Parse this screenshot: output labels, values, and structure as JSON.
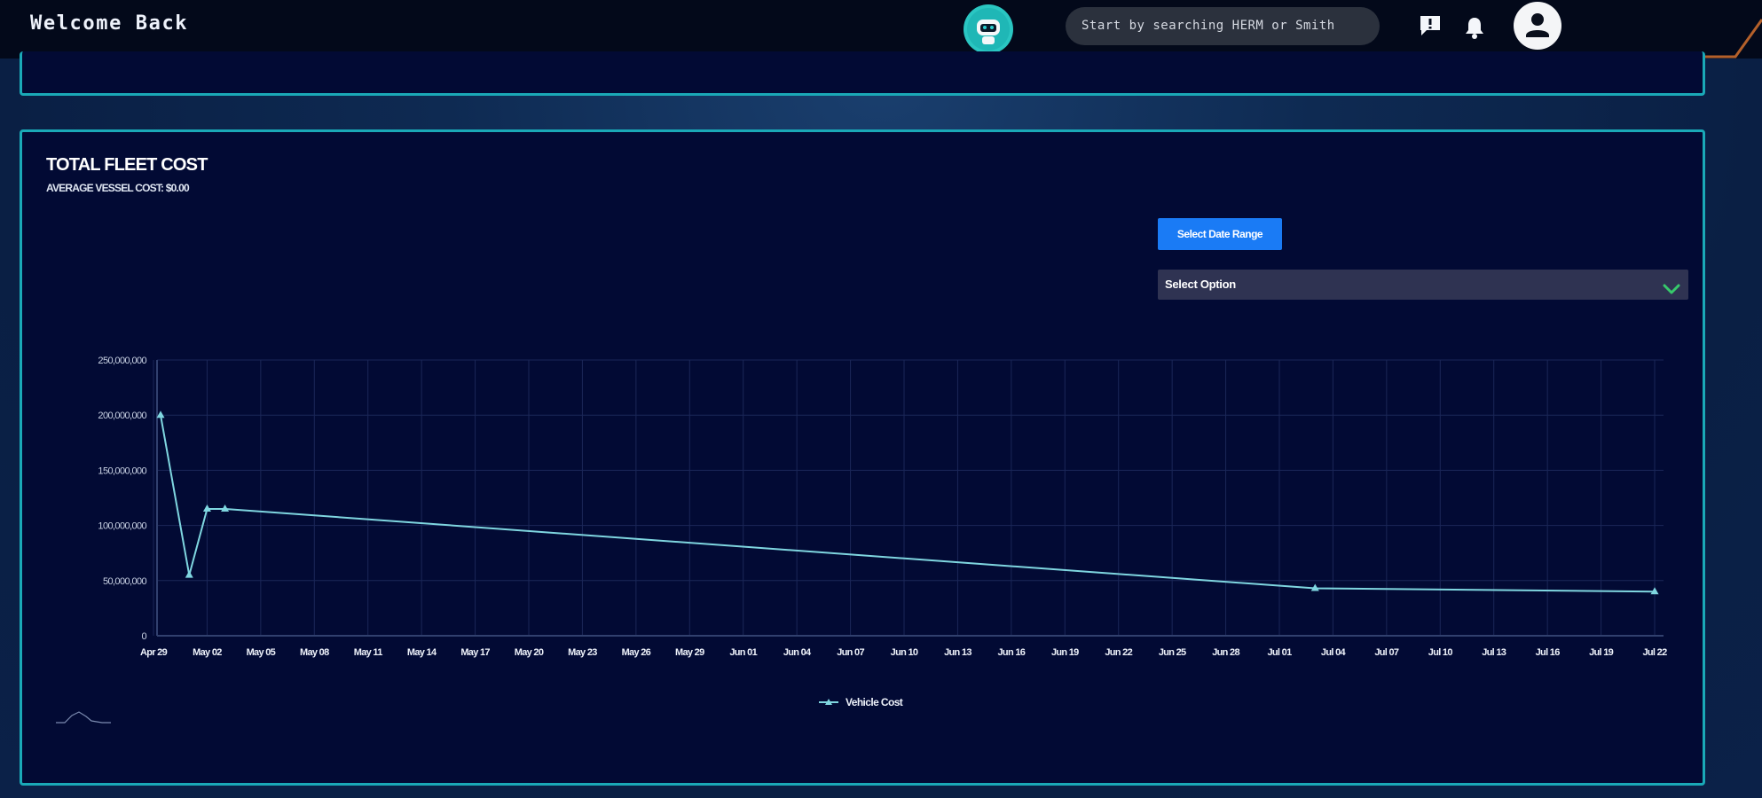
{
  "header": {
    "welcome": "Welcome Back",
    "search_placeholder": "Start by searching HERM or Smith"
  },
  "icons": {
    "logo": "robot-logo-icon",
    "messages": "chat-alert-icon",
    "notifications": "bell-icon",
    "profile": "user-avatar-icon",
    "dropdown": "chevron-down-icon"
  },
  "colors": {
    "accent": "#1aa9b7",
    "primary_button": "#1a7bf5",
    "line": "#7fd6e0",
    "chevron": "#37c96b",
    "header_accent": "#b4602a"
  },
  "panel": {
    "title": "TOTAL FLEET COST",
    "subtitle": "AVERAGE VESSEL COST: $0.00",
    "date_button": "Select Date Range",
    "select_value": "Select Option"
  },
  "chart_data": {
    "type": "line",
    "x": [
      "Apr 29",
      "May 01",
      "May 02",
      "May 03",
      "Jul 03",
      "Jul 22"
    ],
    "series": [
      {
        "name": "Vehicle Cost",
        "values": [
          200000000,
          55000000,
          115000000,
          115000000,
          43000000,
          40000000
        ]
      }
    ],
    "x_ticks": [
      "Apr 29",
      "May 02",
      "May 05",
      "May 08",
      "May 11",
      "May 14",
      "May 17",
      "May 20",
      "May 23",
      "May 26",
      "May 29",
      "Jun 01",
      "Jun 04",
      "Jun 07",
      "Jun 10",
      "Jun 13",
      "Jun 16",
      "Jun 19",
      "Jun 22",
      "Jun 25",
      "Jun 28",
      "Jul 01",
      "Jul 04",
      "Jul 07",
      "Jul 10",
      "Jul 13",
      "Jul 16",
      "Jul 19",
      "Jul 22"
    ],
    "y_ticks": [
      "0",
      "50,000,000",
      "100,000,000",
      "150,000,000",
      "200,000,000",
      "250,000,000"
    ],
    "ylim": [
      0,
      250000000
    ],
    "grid": true,
    "legend": "bottom-center"
  }
}
